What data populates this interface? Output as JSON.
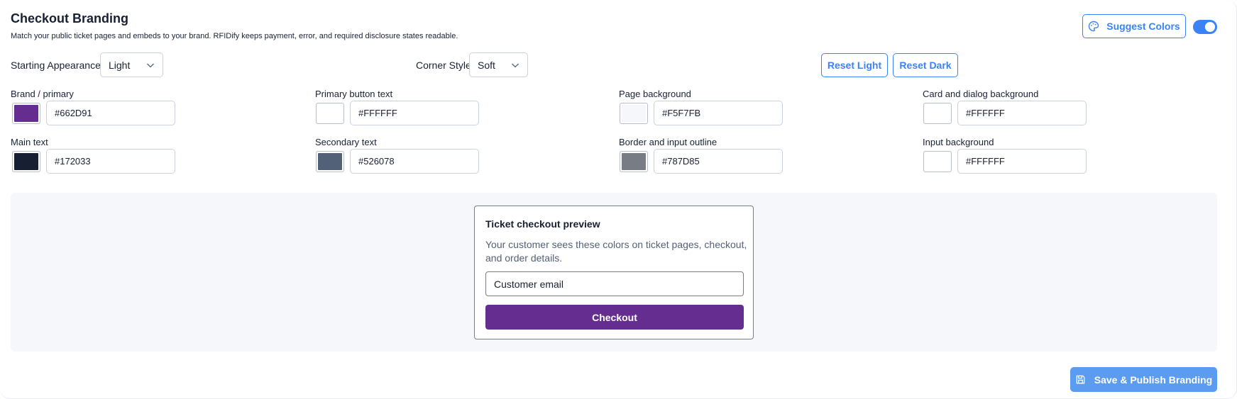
{
  "header": {
    "title": "Checkout Branding",
    "subtitle": "Match your public ticket pages and embeds to your brand. RFIDify keeps payment, error, and required disclosure states readable.",
    "suggest_label": "Suggest Colors",
    "suggest_icon": "palette-icon",
    "toggle_on": true
  },
  "controls": {
    "starting_appearance_label": "Starting Appearance",
    "starting_appearance_value": "Light",
    "corner_style_label": "Corner Style",
    "corner_style_value": "Soft",
    "reset_light_label": "Reset Light",
    "reset_dark_label": "Reset Dark"
  },
  "colors": [
    {
      "label": "Brand / primary",
      "value": "#662D91",
      "swatch": "#662d91"
    },
    {
      "label": "Primary button text",
      "value": "#FFFFFF",
      "swatch": "#ffffff"
    },
    {
      "label": "Page background",
      "value": "#F5F7FB",
      "swatch": "#f5f7fb"
    },
    {
      "label": "Card and dialog background",
      "value": "#FFFFFF",
      "swatch": "#ffffff"
    },
    {
      "label": "Main text",
      "value": "#172033",
      "swatch": "#172033"
    },
    {
      "label": "Secondary text",
      "value": "#526078",
      "swatch": "#526078"
    },
    {
      "label": "Border and input outline",
      "value": "#787D85",
      "swatch": "#787d85"
    },
    {
      "label": "Input background",
      "value": "#FFFFFF",
      "swatch": "#ffffff"
    }
  ],
  "preview": {
    "title": "Ticket checkout preview",
    "text": "Your customer sees these colors on ticket pages, checkout, and order details.",
    "input_value": "Customer email",
    "button_label": "Checkout"
  },
  "footer": {
    "save_label": "Save & Publish Branding",
    "save_icon": "save-icon"
  },
  "accent_color": "#3b82f6"
}
